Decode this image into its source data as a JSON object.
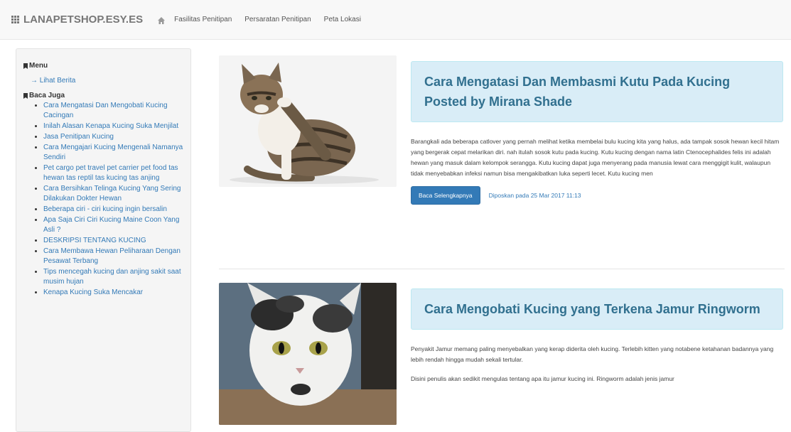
{
  "navbar": {
    "brand": "LANAPETSHOP.ESY.ES",
    "links": [
      "Fasilitas Penitipan",
      "Persaratan Penitipan",
      "Peta Lokasi"
    ]
  },
  "sidebar": {
    "menu_heading": "Menu",
    "menu_link": "→ Lihat Berita",
    "read_heading": "Baca Juga",
    "items": [
      "Cara Mengatasi Dan Mengobati Kucing Cacingan",
      "Inilah Alasan Kenapa Kucing Suka Menjilat",
      "Jasa Penitipan Kucing",
      "Cara Mengajari Kucing Mengenali Namanya Sendiri",
      "Pet cargo pet travel pet carrier pet food tas hewan tas reptil tas kucing tas anjing",
      "Cara Bersihkan Telinga Kucing Yang Sering Dilakukan Dokter Hewan",
      "Beberapa ciri - ciri kucing ingin bersalin",
      "Apa Saja Ciri Ciri Kucing Maine Coon Yang Asli ?",
      "DESKRIPSI TENTANG KUCING",
      "Cara Membawa Hewan Peliharaan Dengan Pesawat Terbang",
      "Tips mencegah kucing dan anjing sakit saat musim hujan",
      "Kenapa Kucing Suka Mencakar"
    ]
  },
  "articles": [
    {
      "title": "Cara Mengatasi Dan Membasmi Kutu Pada Kucing Posted by Mirana Shade",
      "excerpt": "Barangkali ada beberapa catlover yang pernah melihat ketika membelai bulu kucing kita yang halus, ada tampak sosok hewan kecil hitam yang bergerak cepat melarikan diri. nah itulah sosok kutu pada kucing. Kutu kucing dengan nama latin Ctenocephalides felis ini adalah hewan yang masuk dalam kelompok serangga. Kutu kucing dapat juga menyerang pada manusia lewat cara menggigit kulit, walaupun tidak menyebabkan infeksi namun bisa mengakibatkan luka seperti lecet. Kutu kucing men",
      "button": "Baca Selengkapnya",
      "posted": "Diposkan pada 25 Mar 2017 11:13"
    },
    {
      "title": "Cara Mengobati Kucing yang Terkena Jamur Ringworm",
      "excerpt": "Penyakit Jamur memang paling menyebalkan yang kerap diderita oleh kucing. Terlebih kitten yang notabene ketahanan badannya yang lebih rendah hingga mudah sekali tertular.",
      "excerpt2": "Disini penulis akan sedikit mengulas tentang apa itu jamur kucing ini. Ringworm adalah jenis jamur"
    }
  ]
}
